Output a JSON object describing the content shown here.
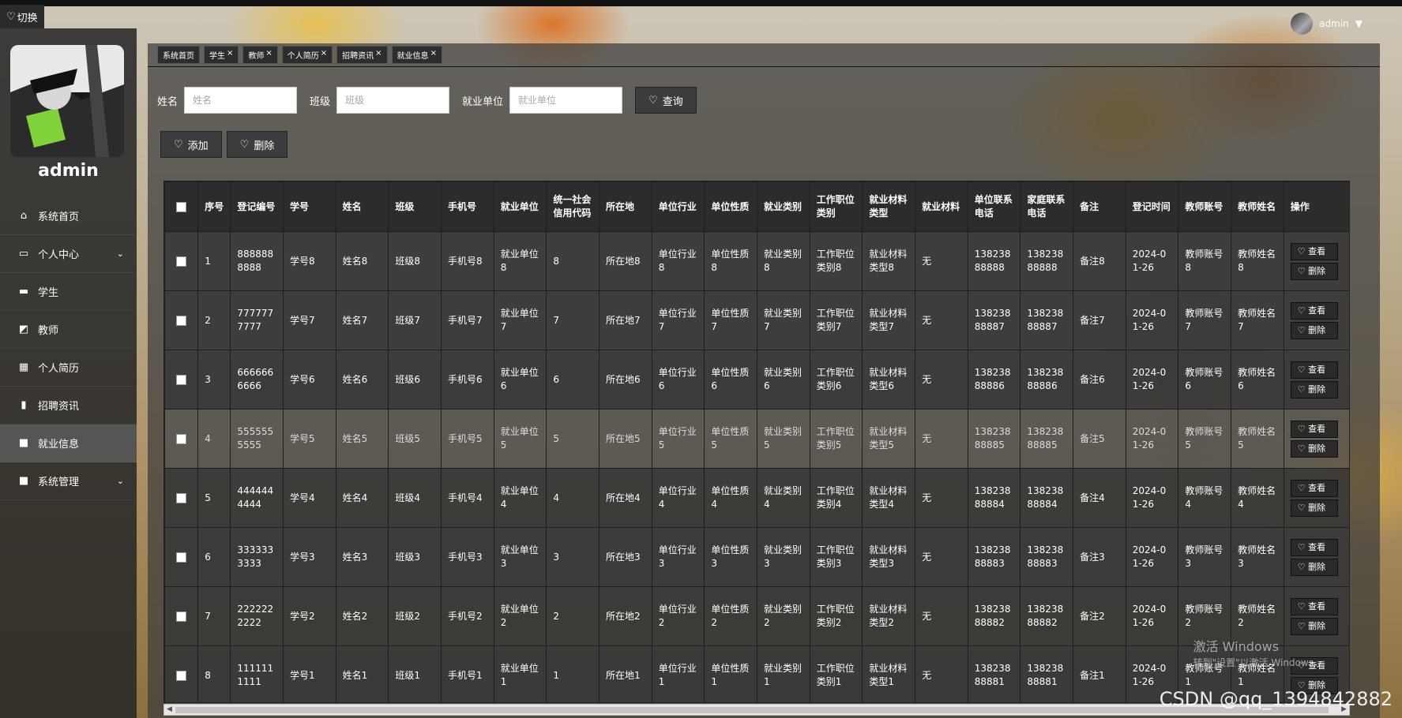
{
  "switch": {
    "label": "切换"
  },
  "user": {
    "name": "admin",
    "header_name": "admin"
  },
  "menu": [
    {
      "label": "系统首页",
      "icon": "home-icon"
    },
    {
      "label": "个人中心",
      "icon": "card-icon",
      "caret": true
    },
    {
      "label": "学生",
      "icon": "monitor-icon"
    },
    {
      "label": "教师",
      "icon": "chart-line-icon"
    },
    {
      "label": "个人简历",
      "icon": "grid-icon"
    },
    {
      "label": "招聘资讯",
      "icon": "bar-chart-icon"
    },
    {
      "label": "就业信息",
      "icon": "apps-icon",
      "active": true
    },
    {
      "label": "系统管理",
      "icon": "apps-icon",
      "caret": true
    }
  ],
  "tabs": [
    {
      "label": "系统首页",
      "closable": false
    },
    {
      "label": "学生",
      "closable": true
    },
    {
      "label": "教师",
      "closable": true
    },
    {
      "label": "个人简历",
      "closable": true
    },
    {
      "label": "招聘资讯",
      "closable": true
    },
    {
      "label": "就业信息",
      "closable": true
    }
  ],
  "search": {
    "name_label": "姓名",
    "name_placeholder": "姓名",
    "class_label": "班级",
    "class_placeholder": "班级",
    "unit_label": "就业单位",
    "unit_placeholder": "就业单位",
    "query_button": "查询"
  },
  "actions": {
    "add": "添加",
    "delete": "删除"
  },
  "table": {
    "columns": [
      "序号",
      "登记编号",
      "学号",
      "姓名",
      "班级",
      "手机号",
      "就业单位",
      "统一社会信用代码",
      "所在地",
      "单位行业",
      "单位性质",
      "就业类别",
      "工作职位类别",
      "就业材料类型",
      "就业材料",
      "单位联系电话",
      "家庭联系电话",
      "备注",
      "登记时间",
      "教师账号",
      "教师姓名",
      "操作"
    ],
    "rows": [
      [
        "1",
        "8888888888",
        "学号8",
        "姓名8",
        "班级8",
        "手机号8",
        "就业单位8",
        "8",
        "所在地8",
        "单位行业8",
        "单位性质8",
        "就业类别8",
        "工作职位类别8",
        "就业材料类型8",
        "无",
        "13823888888",
        "13823888888",
        "备注8",
        "2024-01-26",
        "教师账号8",
        "教师姓名8"
      ],
      [
        "2",
        "7777777777",
        "学号7",
        "姓名7",
        "班级7",
        "手机号7",
        "就业单位7",
        "7",
        "所在地7",
        "单位行业7",
        "单位性质7",
        "就业类别7",
        "工作职位类别7",
        "就业材料类型7",
        "无",
        "13823888887",
        "13823888887",
        "备注7",
        "2024-01-26",
        "教师账号7",
        "教师姓名7"
      ],
      [
        "3",
        "6666666666",
        "学号6",
        "姓名6",
        "班级6",
        "手机号6",
        "就业单位6",
        "6",
        "所在地6",
        "单位行业6",
        "单位性质6",
        "就业类别6",
        "工作职位类别6",
        "就业材料类型6",
        "无",
        "13823888886",
        "13823888886",
        "备注6",
        "2024-01-26",
        "教师账号6",
        "教师姓名6"
      ],
      [
        "4",
        "5555555555",
        "学号5",
        "姓名5",
        "班级5",
        "手机号5",
        "就业单位5",
        "5",
        "所在地5",
        "单位行业5",
        "单位性质5",
        "就业类别5",
        "工作职位类别5",
        "就业材料类型5",
        "无",
        "13823888885",
        "13823888885",
        "备注5",
        "2024-01-26",
        "教师账号5",
        "教师姓名5"
      ],
      [
        "5",
        "4444444444",
        "学号4",
        "姓名4",
        "班级4",
        "手机号4",
        "就业单位4",
        "4",
        "所在地4",
        "单位行业4",
        "单位性质4",
        "就业类别4",
        "工作职位类别4",
        "就业材料类型4",
        "无",
        "13823888884",
        "13823888884",
        "备注4",
        "2024-01-26",
        "教师账号4",
        "教师姓名4"
      ],
      [
        "6",
        "3333333333",
        "学号3",
        "姓名3",
        "班级3",
        "手机号3",
        "就业单位3",
        "3",
        "所在地3",
        "单位行业3",
        "单位性质3",
        "就业类别3",
        "工作职位类别3",
        "就业材料类型3",
        "无",
        "13823888883",
        "13823888883",
        "备注3",
        "2024-01-26",
        "教师账号3",
        "教师姓名3"
      ],
      [
        "7",
        "2222222222",
        "学号2",
        "姓名2",
        "班级2",
        "手机号2",
        "就业单位2",
        "2",
        "所在地2",
        "单位行业2",
        "单位性质2",
        "就业类别2",
        "工作职位类别2",
        "就业材料类型2",
        "无",
        "13823888882",
        "13823888882",
        "备注2",
        "2024-01-26",
        "教师账号2",
        "教师姓名2"
      ],
      [
        "8",
        "1111111111",
        "学号1",
        "姓名1",
        "班级1",
        "手机号1",
        "就业单位1",
        "1",
        "所在地1",
        "单位行业1",
        "单位性质1",
        "就业类别1",
        "工作职位类别1",
        "就业材料类型1",
        "无",
        "13823888881",
        "13823888881",
        "备注1",
        "2024-01-26",
        "教师账号1",
        "教师姓名1"
      ]
    ],
    "row_actions": [
      "查看",
      "删除"
    ]
  },
  "overlay": {
    "windows_activate": "激活 Windows",
    "windows_hint": "转到\"设置\"以激活 Windows。",
    "watermark": "CSDN @qq_1394842882"
  }
}
